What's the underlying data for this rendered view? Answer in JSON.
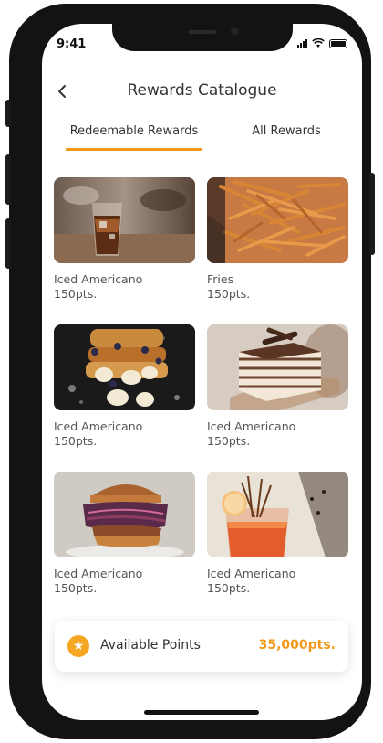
{
  "status_bar": {
    "time": "9:41"
  },
  "header": {
    "title": "Rewards Catalogue",
    "back_icon": "chevron-left-icon"
  },
  "tabs": [
    {
      "label": "Redeemable Rewards",
      "active": true
    },
    {
      "label": "All Rewards",
      "active": false
    }
  ],
  "rewards": [
    {
      "name": "Iced Americano",
      "points": "150pts."
    },
    {
      "name": "Fries",
      "points": "150pts."
    },
    {
      "name": "Iced Americano",
      "points": "150pts."
    },
    {
      "name": "Iced Americano",
      "points": "150pts."
    },
    {
      "name": "Iced Americano",
      "points": "150pts."
    },
    {
      "name": "Iced Americano",
      "points": "150pts."
    }
  ],
  "points_bar": {
    "label": "Available Points",
    "value": "35,000pts.",
    "icon": "star-icon"
  },
  "colors": {
    "accent": "#f19a18",
    "badge": "#f5a623",
    "phone_frame": "#131313"
  }
}
